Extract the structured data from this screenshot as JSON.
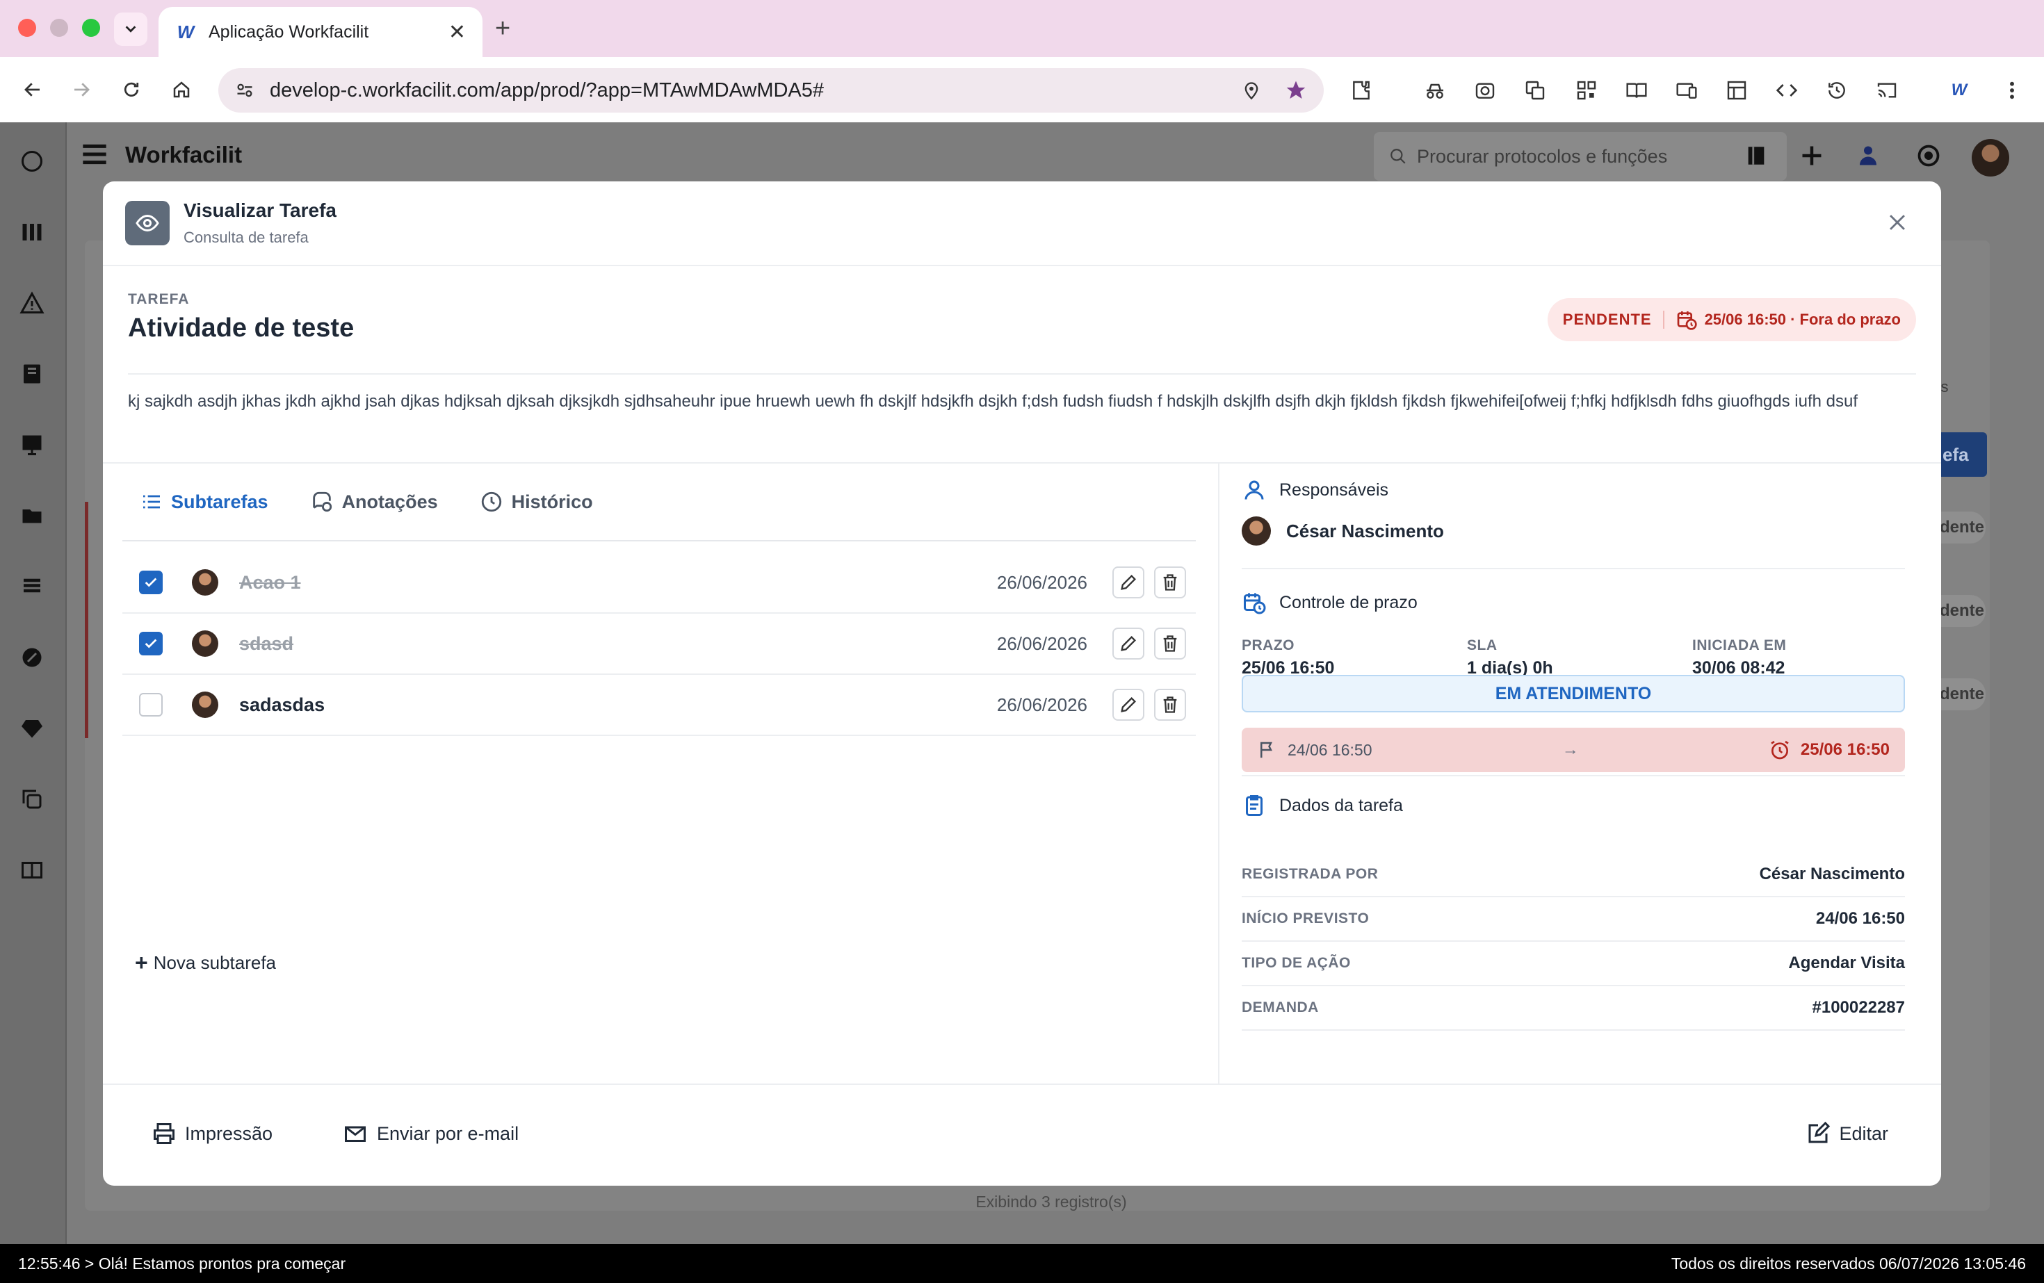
{
  "browser": {
    "tab_title": "Aplicação Workfacilit",
    "url": "develop-c.workfacilit.com/app/prod/?app=MTAwMDAwMDA5#"
  },
  "app": {
    "brand": "Workfacilit",
    "search_placeholder": "Procurar protocolos e funções",
    "bg_footer": "Exibindo 3 registro(s)",
    "bg_fragments": [
      "ros",
      "efa",
      "dente",
      "dente",
      "dente"
    ]
  },
  "modal": {
    "title": "Visualizar Tarefa",
    "subtitle": "Consulta de tarefa",
    "task_label": "TAREFA",
    "task_title": "Atividade de teste",
    "status": "PENDENTE",
    "deadline": "25/06 16:50 · Fora do prazo",
    "description": "kj sajkdh asdjh jkhas jkdh ajkhd jsah djkas hdjksah djksah djksjkdh sjdhsaheuhr ipue hruewh uewh fh dskjlf hdsjkfh dsjkh f;dsh fudsh fiudsh f hdskjlh dskjlfh dsjfh dkjh fjkldsh fjkdsh fjkwehifei[ofweij f;hfkj hdfjklsdh fdhs giuofhgds iufh dsuf",
    "tabs": [
      "Subtarefas",
      "Anotações",
      "Histórico"
    ],
    "subtasks": [
      {
        "name": "Acao 1",
        "date": "26/06/2026",
        "done": true
      },
      {
        "name": "sdasd",
        "date": "26/06/2026",
        "done": true
      },
      {
        "name": "sadasdas",
        "date": "26/06/2026",
        "done": false
      }
    ],
    "new_subtask": "Nova subtarefa",
    "responsaveis_label": "Responsáveis",
    "responsavel": "César Nascimento",
    "prazo_label": "Controle de prazo",
    "kpis": [
      {
        "label": "PRAZO",
        "value": "25/06 16:50"
      },
      {
        "label": "SLA",
        "value": "1 dia(s) 0h"
      },
      {
        "label": "INICIADA EM",
        "value": "30/06 08:42"
      }
    ],
    "attendance": "EM ATENDIMENTO",
    "timeline_start": "24/06 16:50",
    "timeline_arrow": "→",
    "timeline_end": "25/06 16:50",
    "dados_label": "Dados da tarefa",
    "dados": [
      {
        "label": "REGISTRADA POR",
        "value": "César Nascimento"
      },
      {
        "label": "INÍCIO PREVISTO",
        "value": "24/06 16:50"
      },
      {
        "label": "TIPO DE AÇÃO",
        "value": "Agendar Visita"
      },
      {
        "label": "DEMANDA",
        "value": "#100022287"
      }
    ],
    "footer": {
      "print": "Impressão",
      "email": "Enviar por e-mail",
      "edit": "Editar"
    }
  },
  "statusbar": {
    "left": "12:55:46 > Olá! Estamos prontos pra começar",
    "right": "Todos os direitos reservados 06/07/2026 13:05:46"
  },
  "colors": {
    "accent": "#1f66c1",
    "danger": "#b3261e",
    "danger_bg": "#fde8e8"
  }
}
